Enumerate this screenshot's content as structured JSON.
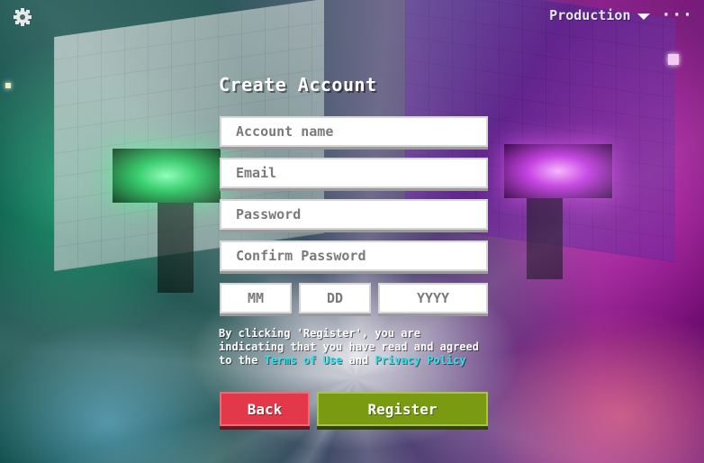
{
  "topbar": {
    "settings_icon": "gear-icon",
    "environment": "Production",
    "environment_dropdown_icon": "caret-down-icon",
    "more_icon": "ellipsis-icon",
    "more_glyph": "···"
  },
  "form": {
    "title": "Create Account",
    "account_name_placeholder": "Account name",
    "email_placeholder": "Email",
    "password_placeholder": "Password",
    "confirm_password_placeholder": "Confirm Password",
    "dob_month_placeholder": "MM",
    "dob_day_placeholder": "DD",
    "dob_year_placeholder": "YYYY"
  },
  "terms": {
    "prefix": "By clicking 'Register', you are indicating that you have read and agreed to the ",
    "terms_link": "Terms of Use",
    "conjunction": " and ",
    "privacy_link": "Privacy Policy"
  },
  "buttons": {
    "back": "Back",
    "register": "Register"
  },
  "colors": {
    "link": "#27e6f0",
    "back_button": "#e2384a",
    "register_button": "#7a9a12"
  }
}
